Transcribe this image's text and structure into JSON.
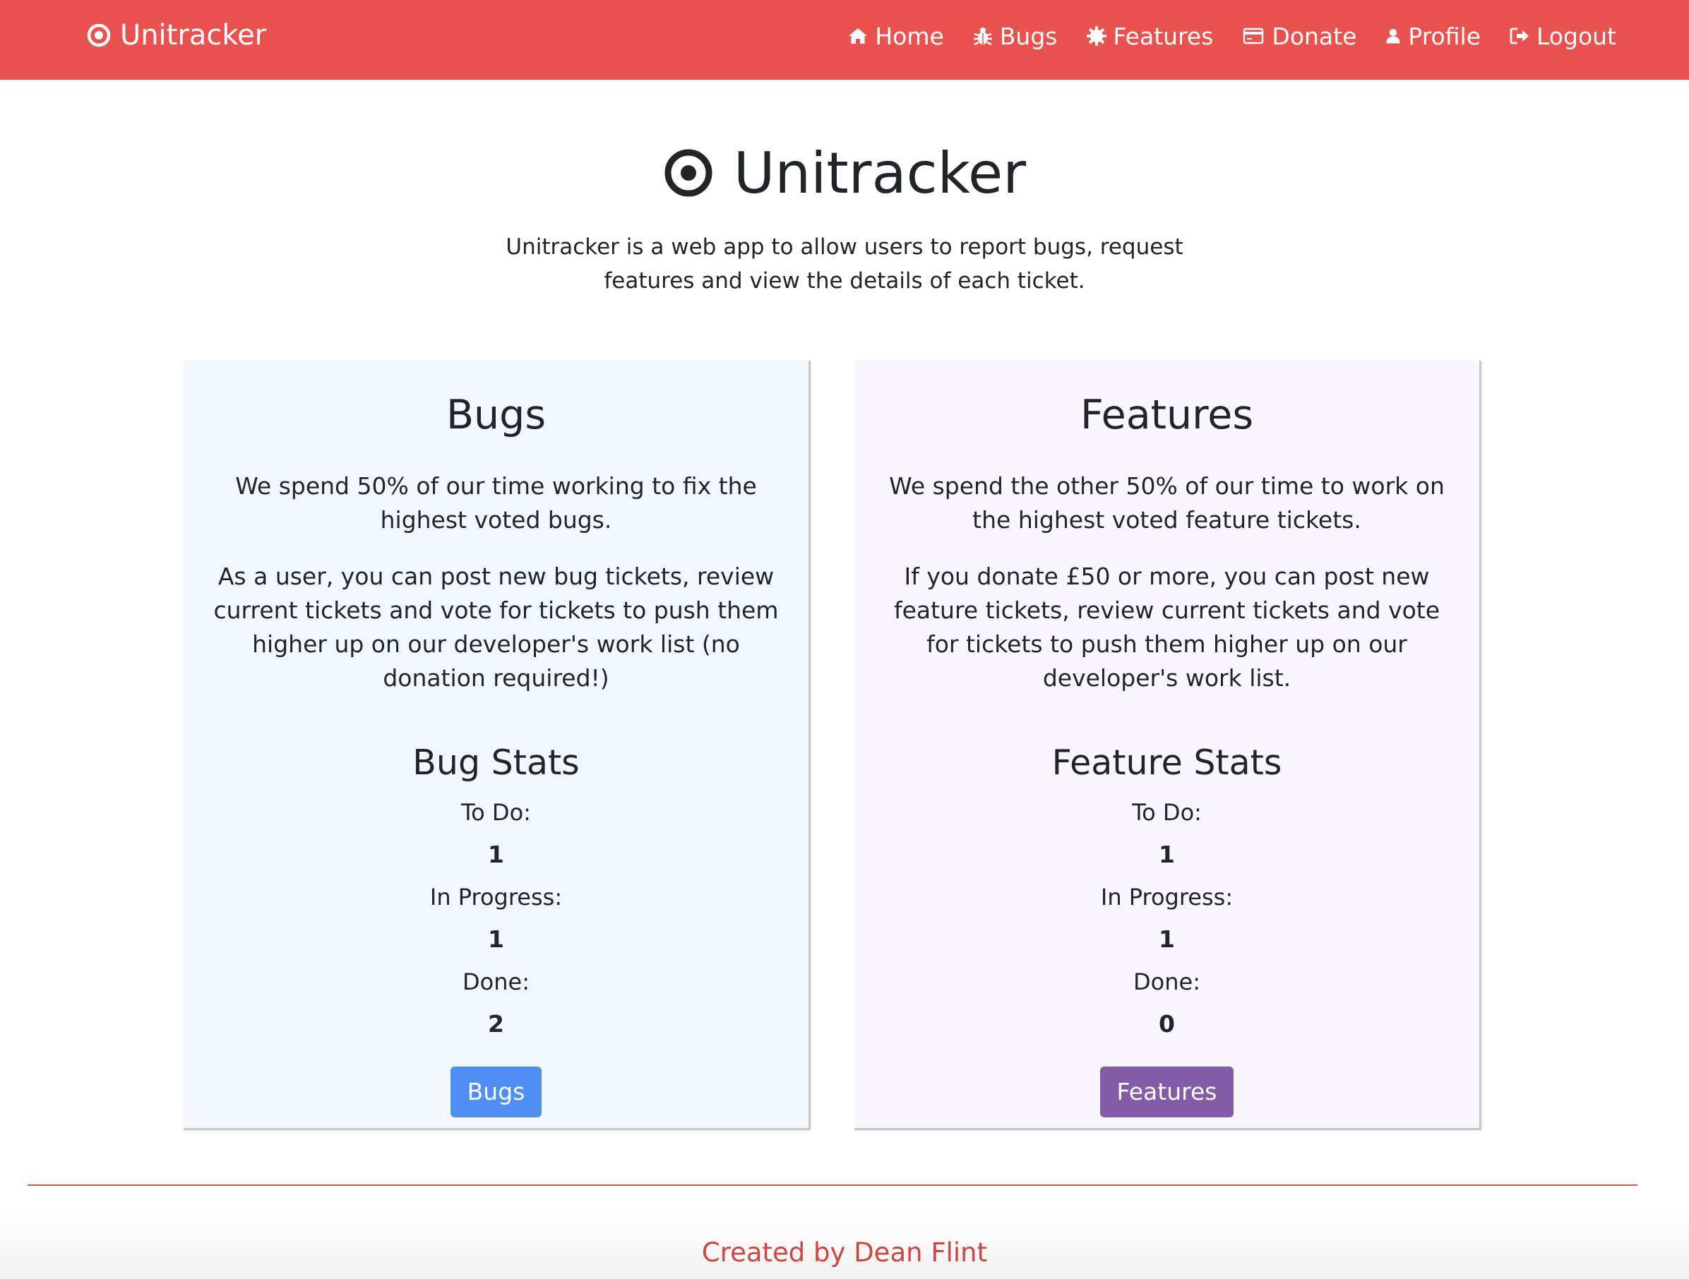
{
  "colors": {
    "navbar_bg": "#e9524e",
    "bugs_card_bg": "#f2f6fd",
    "features_card_bg": "#f8f5fc",
    "bugs_button_bg": "#4f8ef5",
    "features_button_bg": "#835ba6",
    "footer_text": "#d3443f"
  },
  "navbar": {
    "brand": {
      "icon": "target-icon",
      "label": "Unitracker"
    },
    "links": [
      {
        "icon": "home-icon",
        "label": "Home"
      },
      {
        "icon": "bug-icon",
        "label": "Bugs"
      },
      {
        "icon": "gear-icon",
        "label": "Features"
      },
      {
        "icon": "credit-card-icon",
        "label": "Donate"
      },
      {
        "icon": "user-icon",
        "label": "Profile"
      },
      {
        "icon": "sign-out-icon",
        "label": "Logout"
      }
    ]
  },
  "hero": {
    "icon": "target-icon",
    "title": "Unitracker",
    "description": "Unitracker is a web app to allow users to report bugs, request features and view the details of each ticket."
  },
  "bugs_card": {
    "title": "Bugs",
    "paragraphs": [
      "We spend 50% of our time working to fix the highest voted bugs.",
      "As a user, you can post new bug tickets, review current tickets and vote for tickets to push them higher up on our developer's work list (no donation required!)"
    ],
    "stats_title": "Bug Stats",
    "stats": [
      {
        "label": "To Do:",
        "value": "1"
      },
      {
        "label": "In Progress:",
        "value": "1"
      },
      {
        "label": "Done:",
        "value": "2"
      }
    ],
    "button_label": "Bugs"
  },
  "features_card": {
    "title": "Features",
    "paragraphs": [
      "We spend the other 50% of our time to work on the highest voted feature tickets.",
      "If you donate £50 or more, you can post new feature tickets, review current tickets and vote for tickets to push them higher up on our developer's work list."
    ],
    "stats_title": "Feature Stats",
    "stats": [
      {
        "label": "To Do:",
        "value": "1"
      },
      {
        "label": "In Progress:",
        "value": "1"
      },
      {
        "label": "Done:",
        "value": "0"
      }
    ],
    "button_label": "Features"
  },
  "footer": {
    "text": "Created by Dean Flint"
  }
}
